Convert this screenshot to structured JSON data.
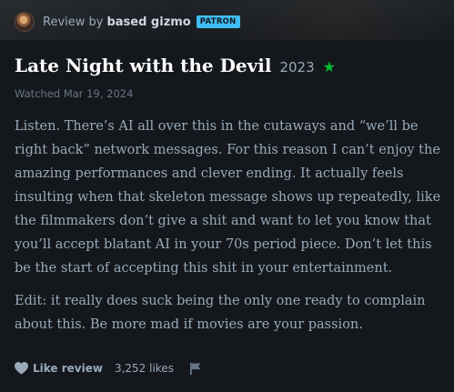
{
  "header": {
    "prefix": "Review by",
    "author": "based gizmo",
    "badge": "PATRON"
  },
  "film": {
    "title": "Late Night with the Devil",
    "year": "2023",
    "rating_icon": "star-icon",
    "watched": "Watched Mar 19, 2024"
  },
  "review": {
    "paragraphs": [
      "Listen. There’s AI all over this in the cutaways and “we’ll be right back” network messages. For this reason I can’t enjoy the amazing performances and clever ending. It actually feels insulting when that skeleton message shows up repeatedly, like the filmmakers don’t give a shit and want to let you know that you’ll accept blatant AI in your 70s period piece. Don’t let this be the start of accepting this shit in your entertainment.",
      "Edit: it really does suck being the only one ready to complain about this. Be more mad if movies are your passion."
    ]
  },
  "footer": {
    "like_label": "Like review",
    "likes_count": "3,252 likes"
  },
  "colors": {
    "background": "#14181c",
    "text": "#99aabb",
    "title": "#ffffff",
    "badge": "#40bcf4",
    "star": "#00c030"
  }
}
